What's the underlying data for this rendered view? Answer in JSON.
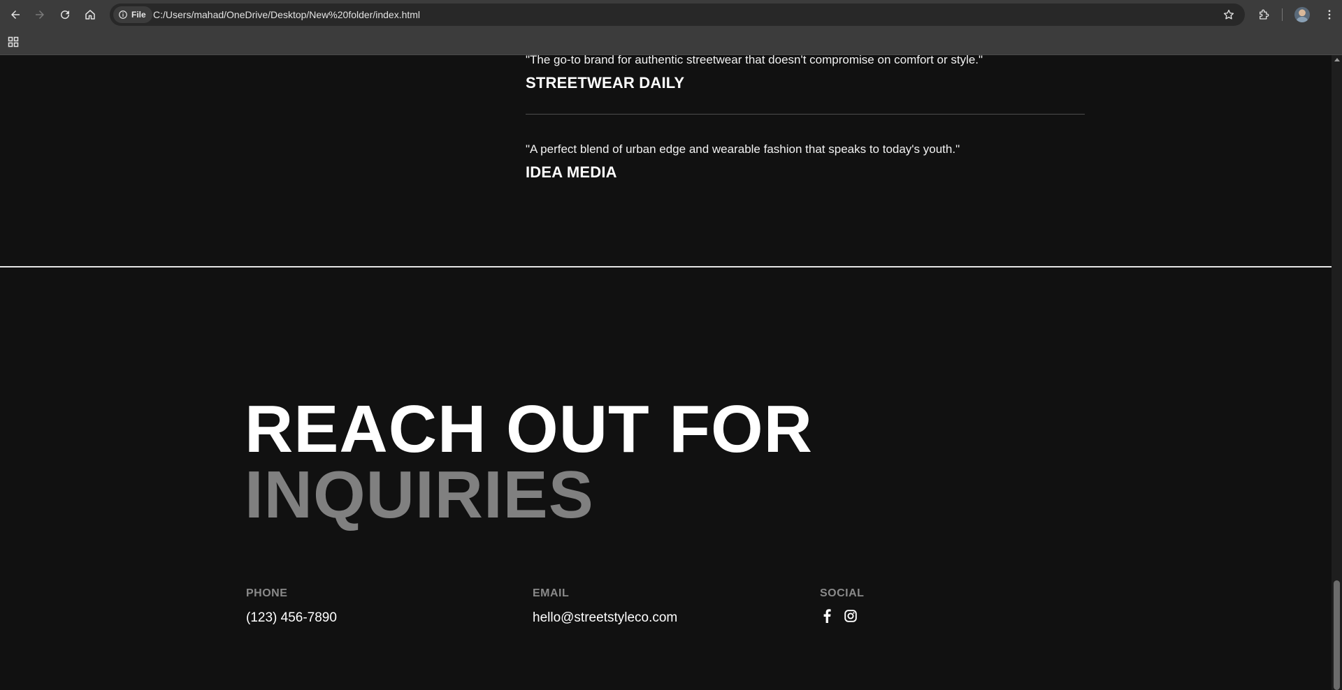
{
  "browser": {
    "site_chip_label": "File",
    "url": "C:/Users/mahad/OneDrive/Desktop/New%20folder/index.html"
  },
  "testimonials": [
    {
      "quote": "\"The go-to brand for authentic streetwear that doesn't compromise on comfort or style.\"",
      "source": "STREETWEAR DAILY"
    },
    {
      "quote": "\"A perfect blend of urban edge and wearable fashion that speaks to today's youth.\"",
      "source": "IDEA MEDIA"
    }
  ],
  "contact_section": {
    "headline_line1": "REACH OUT FOR",
    "headline_line2": "INQUIRIES",
    "phone": {
      "label": "PHONE",
      "value": "(123) 456-7890"
    },
    "email": {
      "label": "EMAIL",
      "value": "hello@streetstyleco.com"
    },
    "social": {
      "label": "SOCIAL",
      "icons": [
        "facebook-icon",
        "instagram-icon"
      ]
    }
  },
  "colors": {
    "page_background": "#111111",
    "headline_primary": "#ffffff",
    "headline_secondary": "#808080",
    "label_gray": "#8a8a8a"
  }
}
